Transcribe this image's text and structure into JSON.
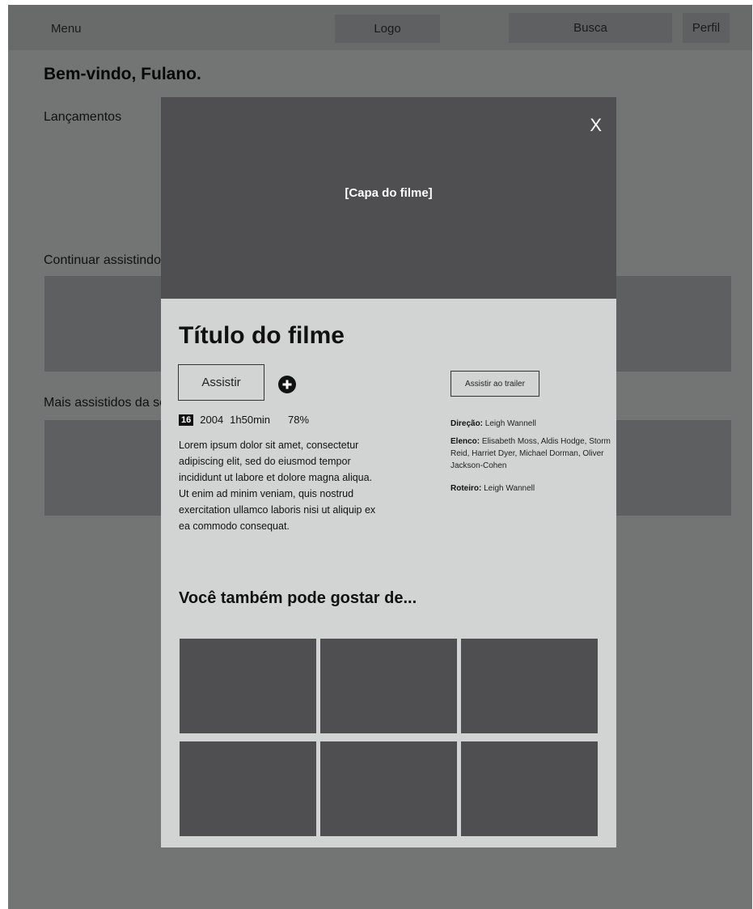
{
  "header": {
    "menu_label": "Menu",
    "logo_label": "Logo",
    "search_label": "Busca",
    "profile_label": "Perfil"
  },
  "welcome": "Bem-vindo, Fulano.",
  "sections": {
    "launches": "Lançamentos",
    "continue_watching": "Continuar assistindo",
    "most_watched": "Mais assistidos da semana"
  },
  "modal": {
    "cover_label": "[Capa do filme]",
    "close_label": "X",
    "title": "Título do filme",
    "watch_label": "Assistir",
    "add_icon": "plus-circle-icon",
    "trailer_label": "Assistir ao trailer",
    "age_rating": "16",
    "year": "2004",
    "duration": "1h50min",
    "rating": "78%",
    "synopsis": "Lorem ipsum dolor sit amet, consectetur adipiscing elit, sed do eiusmod tempor incididunt ut labore et dolore magna aliqua. Ut enim ad minim veniam, quis nostrud exercitation ullamco laboris nisi ut aliquip ex ea commodo consequat.",
    "direction_label": "Direção:",
    "direction_value": "Leigh Wannell",
    "cast_label": "Elenco:",
    "cast_value": "Elisabeth Moss, Aldis Hodge, Storm Reid, Harriet Dyer, Michael Dorman, Oliver Jackson-Cohen",
    "script_label": "Roteiro:",
    "script_value": "Leigh Wannell",
    "suggestions_title": "Você também pode gostar de..."
  }
}
